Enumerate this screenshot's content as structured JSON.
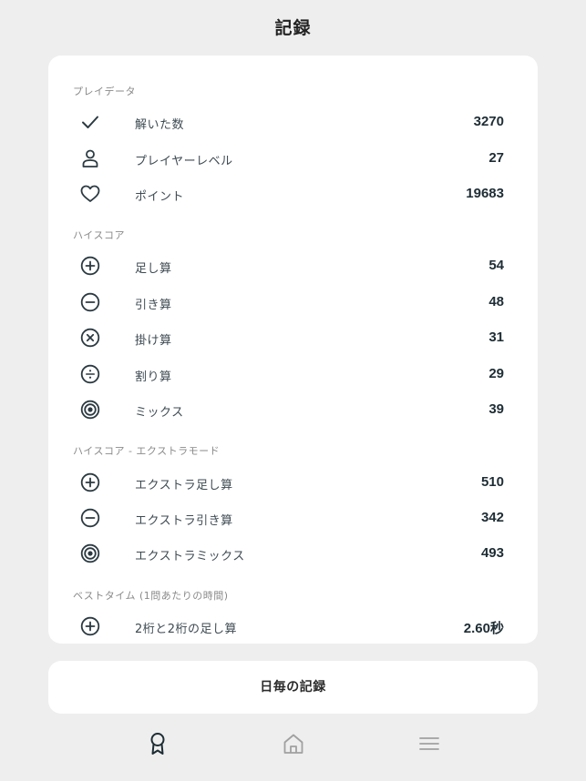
{
  "header": {
    "title": "記録"
  },
  "sections": {
    "player": {
      "title": "プレイデータ",
      "items": [
        {
          "icon": "checkmark-icon",
          "label": "解いた数",
          "value": "3270"
        },
        {
          "icon": "person-icon",
          "label": "プレイヤーレベル",
          "value": "27"
        },
        {
          "icon": "heart-icon",
          "label": "ポイント",
          "value": "19683"
        }
      ]
    },
    "highscore": {
      "title": "ハイスコア",
      "items": [
        {
          "icon": "plus-circle-icon",
          "label": "足し算",
          "value": "54"
        },
        {
          "icon": "minus-circle-icon",
          "label": "引き算",
          "value": "48"
        },
        {
          "icon": "times-circle-icon",
          "label": "掛け算",
          "value": "31"
        },
        {
          "icon": "divide-circle-icon",
          "label": "割り算",
          "value": "29"
        },
        {
          "icon": "target-icon",
          "label": "ミックス",
          "value": "39"
        }
      ]
    },
    "extra": {
      "title": "ハイスコア - エクストラモード",
      "items": [
        {
          "icon": "plus-circle-icon",
          "label": "エクストラ足し算",
          "value": "510"
        },
        {
          "icon": "minus-circle-icon",
          "label": "エクストラ引き算",
          "value": "342"
        },
        {
          "icon": "target-icon",
          "label": "エクストラミックス",
          "value": "493"
        }
      ]
    },
    "besttime": {
      "title": "ベストタイム (1問あたりの時間)",
      "items": [
        {
          "icon": "plus-circle-icon",
          "label": "2桁と2桁の足し算",
          "value": "2.60秒"
        }
      ]
    }
  },
  "daily_button": {
    "label": "日毎の記録"
  },
  "tabbar": {
    "tabs": [
      {
        "icon": "award-icon",
        "active": true
      },
      {
        "icon": "home-icon",
        "active": false
      },
      {
        "icon": "menu-icon",
        "active": false
      }
    ],
    "active_color": "#1e2d35",
    "inactive_color": "#a0a0a0"
  },
  "colors": {
    "background": "#eeeeee",
    "card": "#ffffff",
    "icon": "#2b3a42"
  }
}
